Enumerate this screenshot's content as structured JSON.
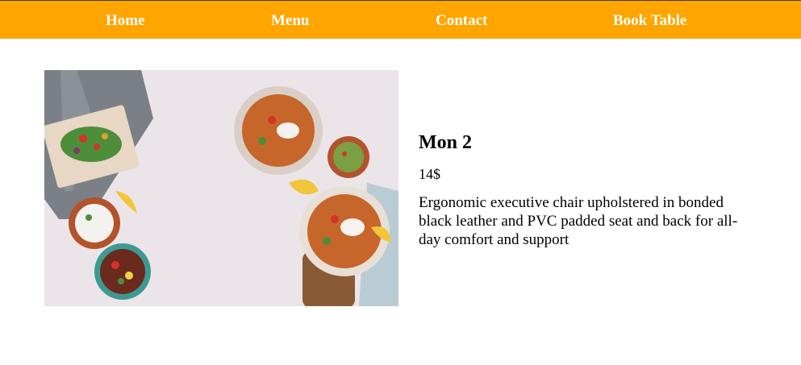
{
  "nav": {
    "home": "Home",
    "menu": "Menu",
    "contact": "Contact",
    "book_table": "Book Table"
  },
  "product": {
    "title": "Mon 2",
    "price": "14$",
    "description": "Ergonomic executive chair upholstered in bonded black leather and PVC padded seat and back for all-day comfort and support"
  },
  "colors": {
    "nav_background": "#ffa500",
    "nav_text": "#ffffff",
    "page_background": "#ffffff"
  }
}
